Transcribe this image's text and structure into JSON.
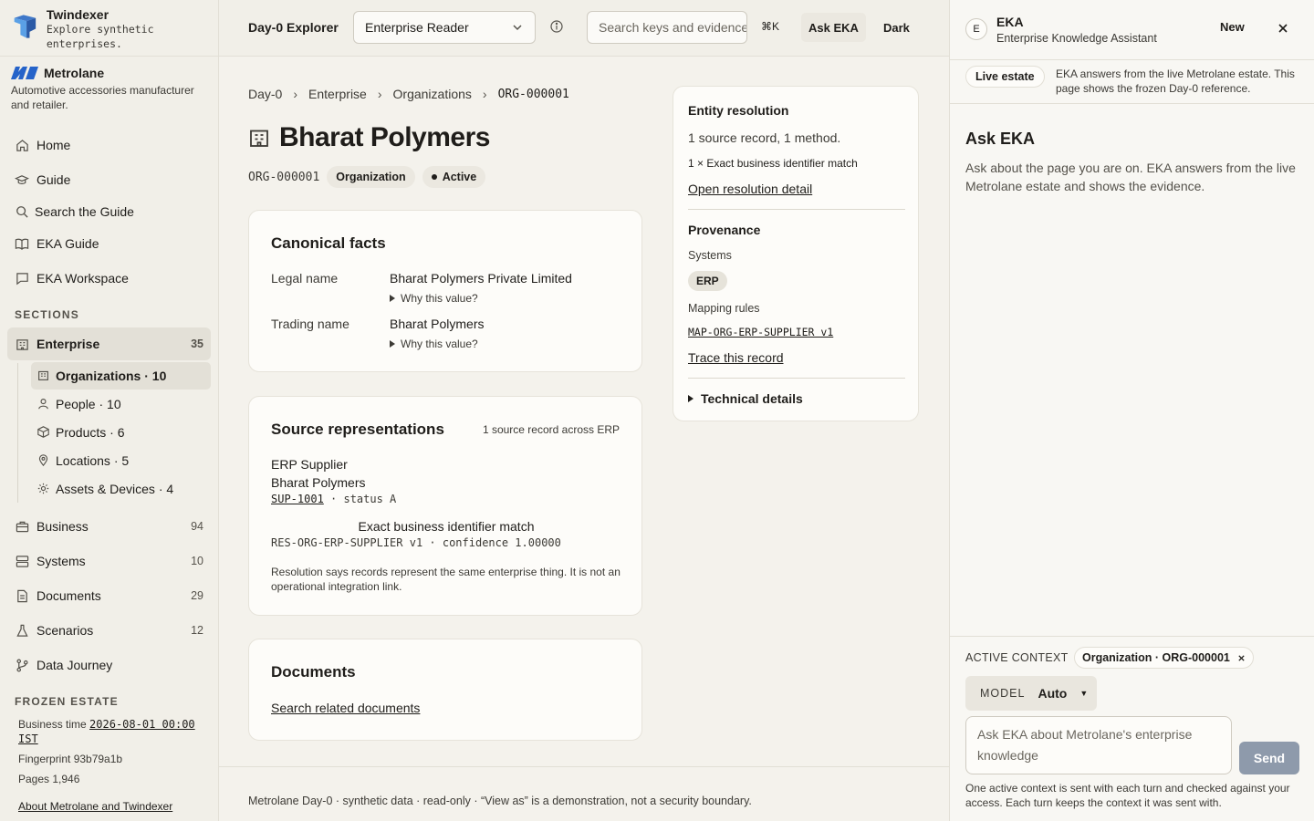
{
  "brand": {
    "name": "Twindexer",
    "tagline": "Explore synthetic enterprises."
  },
  "tenant": {
    "name": "Metrolane",
    "description": "Automotive accessories manufacturer and retailer."
  },
  "nav": {
    "home": "Home",
    "guide": "Guide",
    "search_guide": "Search the Guide",
    "eka_guide": "EKA Guide",
    "eka_workspace": "EKA Workspace",
    "sections_label": "SECTIONS",
    "enterprise": {
      "label": "Enterprise",
      "count": "35"
    },
    "sub": [
      {
        "label": "Organizations · 10"
      },
      {
        "label": "People · 10"
      },
      {
        "label": "Products · 6"
      },
      {
        "label": "Locations · 5"
      },
      {
        "label": "Assets & Devices · 4"
      }
    ],
    "business": {
      "label": "Business",
      "count": "94"
    },
    "systems": {
      "label": "Systems",
      "count": "10"
    },
    "documents": {
      "label": "Documents",
      "count": "29"
    },
    "scenarios": {
      "label": "Scenarios",
      "count": "12"
    },
    "data_journey": "Data Journey"
  },
  "frozen": {
    "label": "FROZEN ESTATE",
    "business_time_label": "Business time",
    "business_time": "2026-08-01 00:00 IST",
    "fingerprint": "Fingerprint 93b79a1b",
    "pages": "Pages 1,946",
    "about": "About Metrolane and Twindexer"
  },
  "topbar": {
    "title": "Day-0 Explorer",
    "view_as": "Enterprise Reader",
    "search_placeholder": "Search keys and evidence",
    "shortcut": "⌘K",
    "ask_eka": "Ask EKA",
    "dark": "Dark"
  },
  "breadcrumb": [
    "Day-0",
    "Enterprise",
    "Organizations",
    "ORG-000001"
  ],
  "entity": {
    "name": "Bharat Polymers",
    "id": "ORG-000001",
    "type": "Organization",
    "status": "Active"
  },
  "canonical": {
    "title": "Canonical facts",
    "legal_label": "Legal name",
    "legal_value": "Bharat Polymers Private Limited",
    "trading_label": "Trading name",
    "trading_value": "Bharat Polymers",
    "why": "Why this value?"
  },
  "sources": {
    "title": "Source representations",
    "summary": "1 source record across ERP",
    "system": "ERP Supplier",
    "name": "Bharat Polymers",
    "key": "SUP-1001",
    "status": "· status A",
    "match": "Exact business identifier match",
    "rule": "RES-ORG-ERP-SUPPLIER v1 · confidence 1.00000",
    "note": "Resolution says records represent the same enterprise thing. It is not an operational integration link."
  },
  "documents": {
    "title": "Documents",
    "link": "Search related documents"
  },
  "resolution": {
    "title": "Entity resolution",
    "summary": "1 source record, 1 method.",
    "method": "1 × Exact business identifier match",
    "link": "Open resolution detail"
  },
  "provenance": {
    "title": "Provenance",
    "systems_label": "Systems",
    "system": "ERP",
    "mapping_label": "Mapping rules",
    "mapping": "MAP-ORG-ERP-SUPPLIER v1",
    "trace": "Trace this record",
    "technical": "Technical details"
  },
  "footer": "Metrolane Day-0 · synthetic data · read-only · “View as” is a demonstration, not a security boundary.",
  "assistant": {
    "avatar": "E",
    "name": "EKA",
    "subtitle": "Enterprise Knowledge Assistant",
    "new": "New",
    "live_badge": "Live estate",
    "live_text": "EKA answers from the live Metrolane estate. This page shows the frozen Day-0 reference.",
    "title": "Ask EKA",
    "description": "Ask about the page you are on. EKA answers from the live Metrolane estate and shows the evidence.",
    "context_label": "ACTIVE CONTEXT",
    "context_chip": "Organization · ORG-000001",
    "model_label": "MODEL",
    "model_value": "Auto",
    "input_placeholder": "Ask EKA about Metrolane's enterprise knowledge",
    "send": "Send",
    "note": "One active context is sent with each turn and checked against your access. Each turn keeps the context it was sent with."
  }
}
